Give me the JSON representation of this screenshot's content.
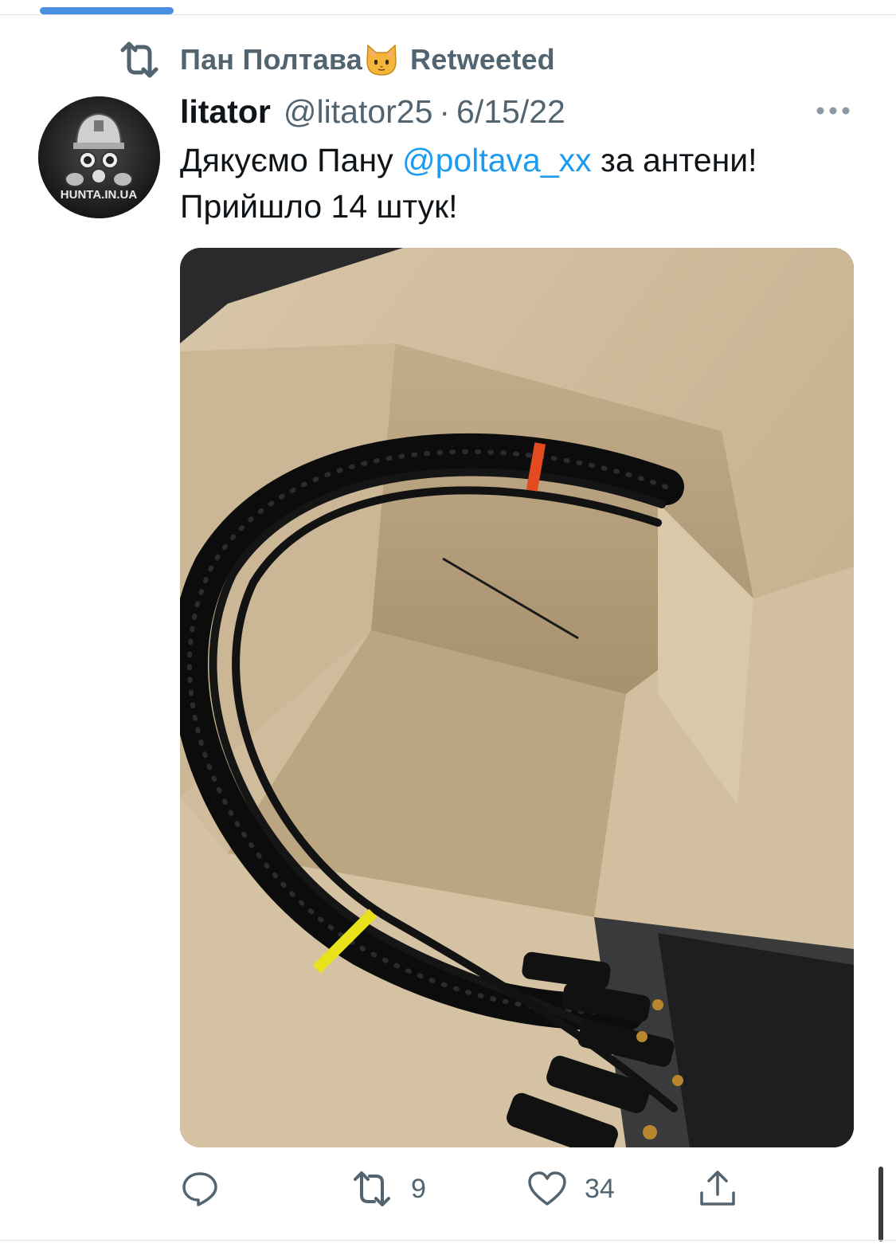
{
  "retweet_bar": {
    "retweeter_name": "Пан Полтава",
    "retweeter_emoji": "cat-face",
    "label": "Retweeted"
  },
  "tweet": {
    "author_name": "litator",
    "author_handle": "@litator25",
    "separator": "·",
    "date": "6/15/22",
    "avatar_text": "HUNTA.IN.UA",
    "text_line1_before": "Дякуємо Пану",
    "mention": "@poltava_xx",
    "text_line1_after": "за антени!",
    "text_line2": "Прийшло 14 штук!",
    "image_alt": "Cardboard box with bundled black antenna cables"
  },
  "actions": {
    "reply_icon": "reply-icon",
    "retweet_icon": "retweet-icon",
    "retweet_count": "9",
    "like_icon": "heart-icon",
    "like_count": "34",
    "share_icon": "share-icon"
  },
  "colors": {
    "accent": "#1d9bf0",
    "muted": "#536471",
    "text": "#0f1419",
    "top_indicator": "#4a90e2"
  }
}
